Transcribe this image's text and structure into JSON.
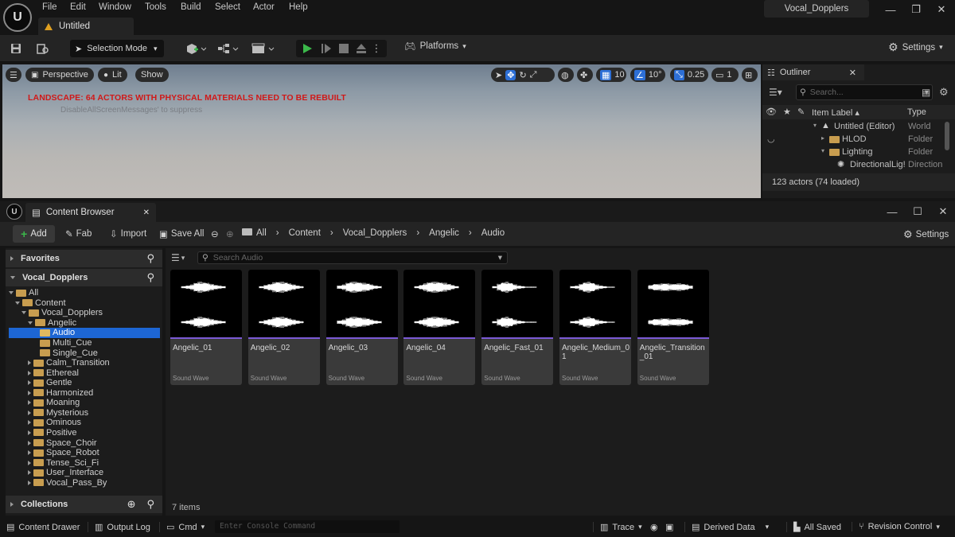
{
  "titlebar": {
    "logo_text": "U",
    "menus": [
      "File",
      "Edit",
      "Window",
      "Tools",
      "Build",
      "Select",
      "Actor",
      "Help"
    ],
    "doc_tab": "Untitled",
    "project": "Vocal_Dopplers"
  },
  "toolbar": {
    "selection_mode": "Selection Mode",
    "platforms": "Platforms",
    "settings": "Settings"
  },
  "viewport": {
    "perspective": "Perspective",
    "lit": "Lit",
    "show": "Show",
    "warning": "LANDSCAPE: 64 ACTORS WITH PHYSICAL MATERIALS NEED TO BE REBUILT",
    "suppress": "DisableAllScreenMessages' to suppress",
    "grid_snap": "10",
    "rot_snap": "10°",
    "scale_snap": "0.25",
    "camera_speed": "1"
  },
  "outliner": {
    "title": "Outliner",
    "search_placeholder": "Search...",
    "col_label": "Item Label ▴",
    "col_type": "Type",
    "rows": [
      {
        "label": "Untitled (Editor)",
        "type": "World"
      },
      {
        "label": "HLOD",
        "type": "Folder"
      },
      {
        "label": "Lighting",
        "type": "Folder"
      },
      {
        "label": "DirectionalLig!",
        "type": "Direction"
      }
    ],
    "footer": "123 actors (74 loaded)"
  },
  "content_browser": {
    "tab": "Content Browser",
    "add": "Add",
    "fab": "Fab",
    "import": "Import",
    "save_all": "Save All",
    "settings": "Settings",
    "breadcrumb": [
      "All",
      "Content",
      "Vocal_Dopplers",
      "Angelic",
      "Audio"
    ],
    "favorites": "Favorites",
    "project_section": "Vocal_Dopplers",
    "collections": "Collections",
    "search_placeholder": "Search Audio",
    "tree": [
      {
        "label": "All",
        "depth": 0,
        "open": true
      },
      {
        "label": "Content",
        "depth": 1,
        "open": true
      },
      {
        "label": "Vocal_Dopplers",
        "depth": 2,
        "open": true
      },
      {
        "label": "Angelic",
        "depth": 3,
        "open": true
      },
      {
        "label": "Audio",
        "depth": 4,
        "selected": true
      },
      {
        "label": "Multi_Cue",
        "depth": 4
      },
      {
        "label": "Single_Cue",
        "depth": 4
      },
      {
        "label": "Calm_Transition",
        "depth": 3
      },
      {
        "label": "Ethereal",
        "depth": 3
      },
      {
        "label": "Gentle",
        "depth": 3
      },
      {
        "label": "Harmonized",
        "depth": 3
      },
      {
        "label": "Moaning",
        "depth": 3
      },
      {
        "label": "Mysterious",
        "depth": 3
      },
      {
        "label": "Ominous",
        "depth": 3
      },
      {
        "label": "Positive",
        "depth": 3
      },
      {
        "label": "Space_Choir",
        "depth": 3
      },
      {
        "label": "Space_Robot",
        "depth": 3
      },
      {
        "label": "Tense_Sci_Fi",
        "depth": 3
      },
      {
        "label": "User_Interface",
        "depth": 3
      },
      {
        "label": "Vocal_Pass_By",
        "depth": 3
      }
    ],
    "assets": [
      {
        "name": "Angelic_01",
        "type": "Sound Wave"
      },
      {
        "name": "Angelic_02",
        "type": "Sound Wave"
      },
      {
        "name": "Angelic_03",
        "type": "Sound Wave"
      },
      {
        "name": "Angelic_04",
        "type": "Sound Wave"
      },
      {
        "name": "Angelic_Fast_01",
        "type": "Sound Wave"
      },
      {
        "name": "Angelic_Medium_01",
        "type": "Sound Wave"
      },
      {
        "name": "Angelic_Transition_01",
        "type": "Sound Wave"
      }
    ],
    "item_count": "7 items"
  },
  "statusbar": {
    "content_drawer": "Content Drawer",
    "output_log": "Output Log",
    "cmd": "Cmd",
    "console_placeholder": "Enter Console Command",
    "trace": "Trace",
    "derived_data": "Derived Data",
    "all_saved": "All Saved",
    "revision_control": "Revision Control"
  },
  "colors": {
    "accent_blue": "#1d66d4",
    "play_green": "#3bb84a",
    "warning_red": "#d01818",
    "folder": "#c89d4f",
    "audio_underline": "#7b5ad6"
  }
}
